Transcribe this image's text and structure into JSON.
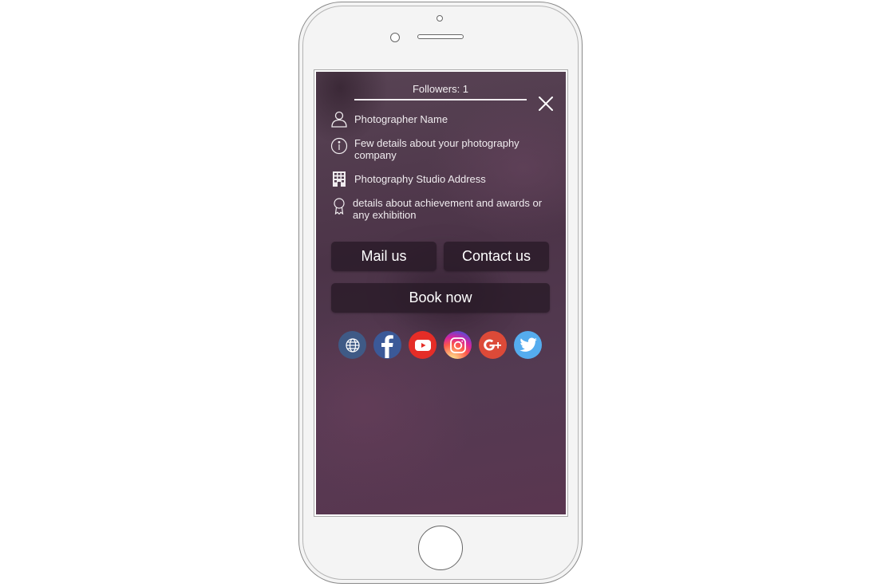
{
  "profile": {
    "followers_label": "Followers: 1",
    "photographer_name": "Photographer Name",
    "company_details": "Few details about your photography company",
    "studio_address": "Photography Studio Address",
    "achievements": "details about achievement and awards or any exhibition"
  },
  "actions": {
    "mail_label": "Mail us",
    "contact_label": "Contact us",
    "book_label": "Book now"
  },
  "icons": {
    "close": "close-icon",
    "name": "user-icon",
    "details": "info-icon",
    "address": "building-icon",
    "awards": "award-ribbon-icon"
  },
  "social": [
    {
      "name": "website",
      "icon": "globe-icon",
      "color": "#3f5a86"
    },
    {
      "name": "facebook",
      "icon": "facebook-icon",
      "color": "#3b5998"
    },
    {
      "name": "youtube",
      "icon": "youtube-icon",
      "color": "#e52d27"
    },
    {
      "name": "instagram",
      "icon": "instagram-icon",
      "color": "#c13584"
    },
    {
      "name": "google-plus",
      "icon": "google-plus-icon",
      "color": "#dc4a38"
    },
    {
      "name": "twitter",
      "icon": "twitter-icon",
      "color": "#55acee"
    }
  ],
  "colors": {
    "background": "#4e3a4c",
    "button_bg": "#2b1f2a",
    "text": "#f0ecef"
  }
}
